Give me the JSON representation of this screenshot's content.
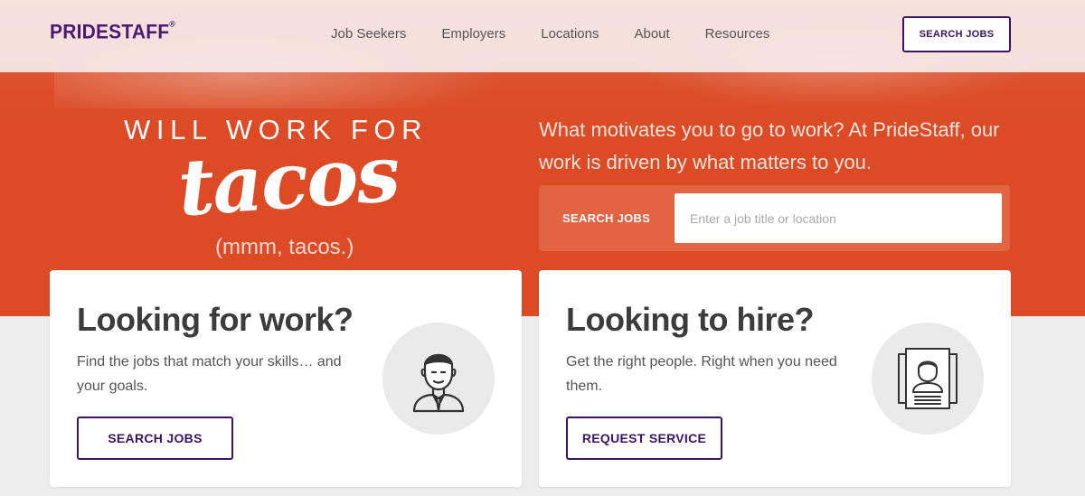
{
  "header": {
    "logo_text": "PRIDESTAFF",
    "logo_mark": "®",
    "nav": [
      "Job Seekers",
      "Employers",
      "Locations",
      "About",
      "Resources"
    ],
    "cta_label": "SEARCH JOBS"
  },
  "hero": {
    "tagline_top": "WILL WORK FOR",
    "tagline_script": "tacos",
    "tagline_sub": "(mmm, tacos.)",
    "intro": "What motivates you to go to work? At PrideStaff, our work is driven by what matters to you.",
    "search_label": "SEARCH JOBS",
    "search_placeholder": "Enter a job title or location",
    "search_value": ""
  },
  "cards": {
    "seeker": {
      "title": "Looking for work?",
      "body": "Find the jobs that match your skills… and your goals.",
      "button": "SEARCH JOBS",
      "icon": "job-seeker-icon"
    },
    "employer": {
      "title": "Looking to hire?",
      "body": "Get the right people. Right when you need them.",
      "button": "REQUEST SERVICE",
      "icon": "resume-icon"
    }
  },
  "colors": {
    "brand_purple": "#3b1463",
    "hero_orange": "#dc4b25",
    "page_gray": "#ededed"
  }
}
